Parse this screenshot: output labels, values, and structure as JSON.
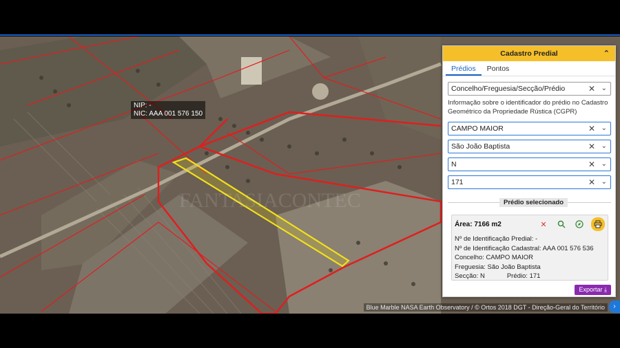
{
  "map": {
    "tooltip": {
      "nip": "NIP: -",
      "nic": "NIC: AAA 001 576 150"
    },
    "attribution": "Blue Marble NASA Earth Observatory / © Ortos 2018 DGT - Direção-Geral do Território",
    "colors": {
      "parcel_border": "#e01e1e",
      "selected_parcel": "#f2e01c"
    }
  },
  "panel": {
    "title": "Cadastro Predial",
    "tabs": [
      "Prédios",
      "Pontos"
    ],
    "active_tab": "Prédios",
    "search_select": {
      "value": "Concelho/Freguesia/Secção/Prédio"
    },
    "info_text": "Informação sobre o identificador do prédio no Cadastro Geométrico da Propriedade Rústica (CGPR)",
    "fields": {
      "concelho": "CAMPO MAIOR",
      "freguesia": "São João Baptista",
      "seccao": "N",
      "predio": "171"
    },
    "selected": {
      "section_title": "Prédio selecionado",
      "area": "Área: 7166 m2",
      "lines": [
        "Nº de Identificação Predial: -",
        "Nº de Identificação Cadastral: AAA 001 576 536",
        "Concelho: CAMPO MAIOR",
        "Freguesia: São João Baptista"
      ],
      "seccao": "Secção: N",
      "predio": "Prédio: 171"
    },
    "export_label": "Exportar",
    "accent": "#f5bf2a",
    "link_color": "#1b63c6",
    "export_color": "#8a2ab0"
  }
}
